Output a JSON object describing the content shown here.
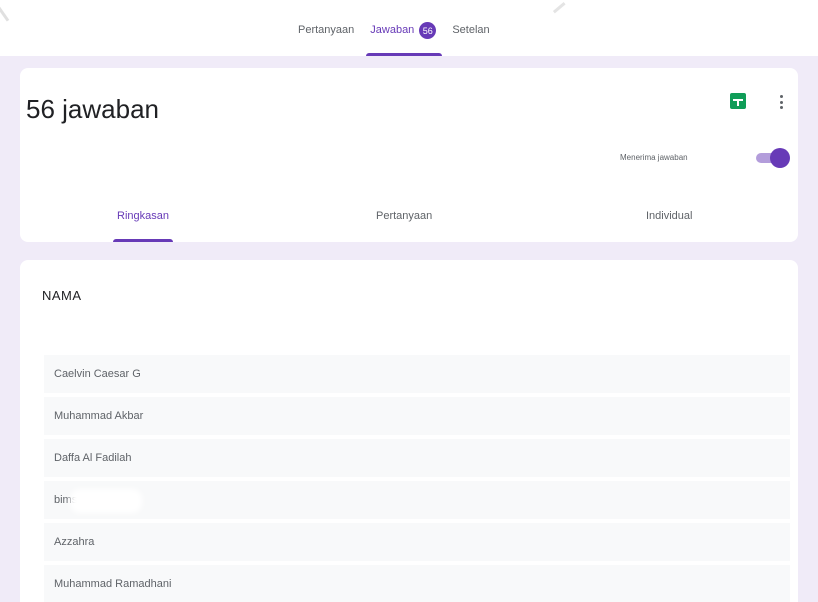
{
  "top_tabs": {
    "questions": "Pertanyaan",
    "responses": "Jawaban",
    "responses_count": "56",
    "settings": "Setelan"
  },
  "header": {
    "title": "56 jawaban",
    "accepting_label": "Menerima jawaban",
    "accepting": true,
    "icons": {
      "sheets": "google-sheets-icon",
      "more": "more-vert-icon"
    }
  },
  "sub_tabs": {
    "summary": "Ringkasan",
    "question": "Pertanyaan",
    "individual": "Individual",
    "active": "summary"
  },
  "question": {
    "title": "NAMA",
    "answers": [
      "Caelvin Caesar G",
      "Muhammad Akbar",
      "Daffa Al Fadilah",
      "bims",
      "Azzahra",
      "Muhammad Ramadhani"
    ]
  },
  "colors": {
    "accent": "#673ab7",
    "background": "#f0ebf8",
    "sheets_green": "#0f9d58"
  }
}
